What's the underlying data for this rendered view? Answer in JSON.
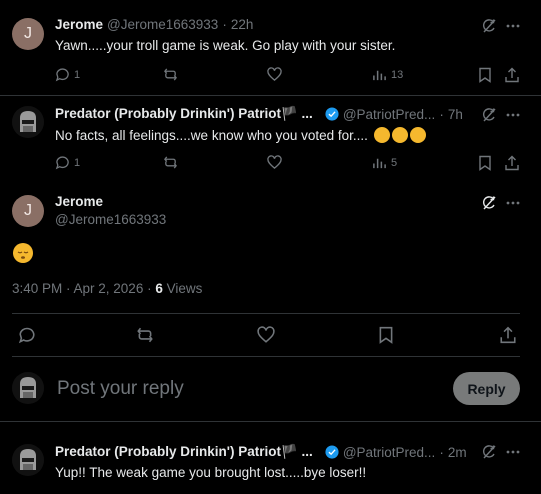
{
  "tweet1": {
    "name": "Jerome",
    "handle": "@Jerome1663933",
    "time": "22h",
    "text": "Yawn.....your troll game is weak. Go play with your sister.",
    "avatar_letter": "J",
    "replies": "1",
    "views": "13"
  },
  "tweet2": {
    "name": "Predator (Probably Drinkin') Patriot🏴 ...",
    "handle": "@PatriotPred...",
    "time": "7h",
    "text": "No facts, all feelings....we know who you voted for....",
    "replies": "1",
    "views": "5"
  },
  "main_tweet": {
    "name": "Jerome",
    "handle": "@Jerome1663933",
    "avatar_letter": "J",
    "time_date": "3:40 PM · Apr 2, 2026 · ",
    "views_count": "6",
    "views_label": "Views"
  },
  "reply_box": {
    "placeholder": "Post your reply",
    "button": "Reply"
  },
  "tweet3": {
    "name": "Predator (Probably Drinkin') Patriot🏴 ...",
    "handle": "@PatriotPred...",
    "time": "2m",
    "text": "Yup!! The weak game you brought lost.....bye loser!!"
  },
  "colors": {
    "background": "#000000",
    "text": "#e7e9ea",
    "muted": "#71767b",
    "verified": "#1d9bf0",
    "divider": "#2f3336"
  }
}
